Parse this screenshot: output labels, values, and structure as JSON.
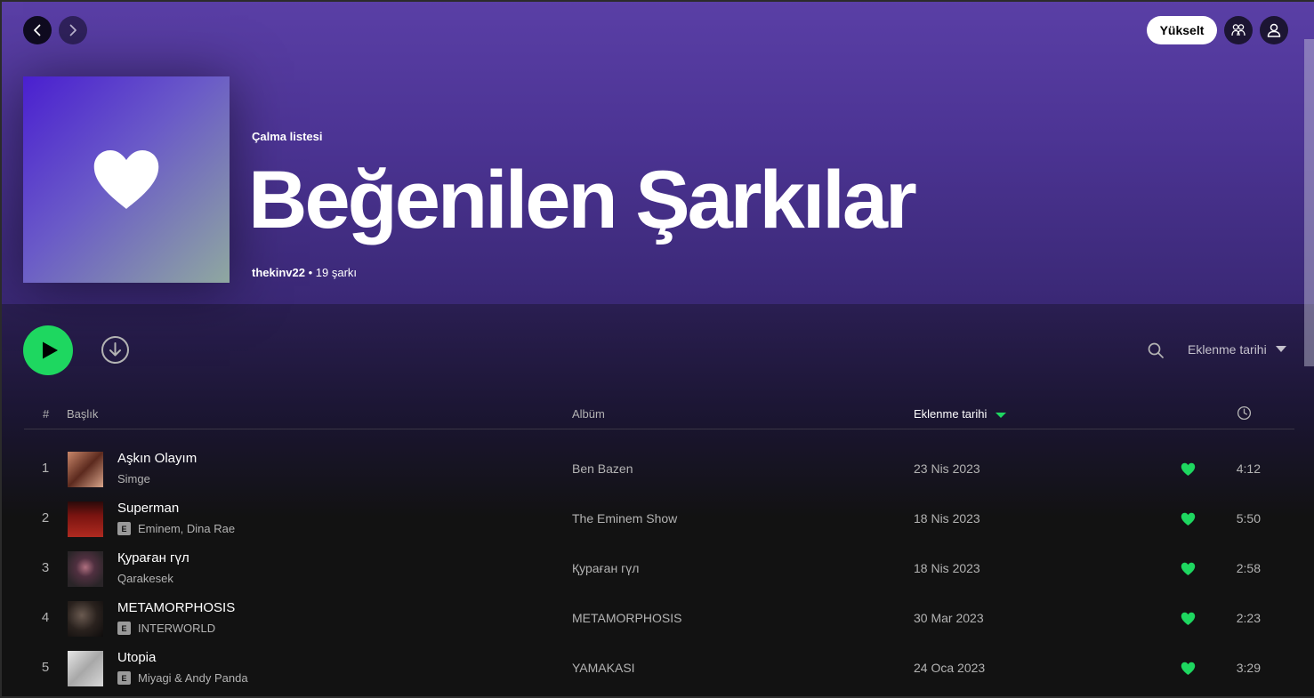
{
  "topbar": {
    "upgrade_label": "Yükselt",
    "icons": {
      "back": "chevron-left-icon",
      "forward": "chevron-right-icon",
      "friends": "friends-icon",
      "user": "user-icon"
    }
  },
  "playlist": {
    "type_label": "Çalma listesi",
    "title": "Beğenilen Şarkılar",
    "owner": "thekinv22",
    "separator": " • ",
    "song_count": "19 şarkı",
    "cover_icon": "heart-icon"
  },
  "actions": {
    "sort_label": "Eklenme tarihi"
  },
  "table": {
    "headers": {
      "number": "#",
      "title": "Başlık",
      "album": "Albüm",
      "date_added": "Eklenme tarihi",
      "duration_icon": "clock-icon"
    },
    "rows": [
      {
        "number": "1",
        "title": "Aşkın Olayım",
        "artist": "Simge",
        "explicit": false,
        "album": "Ben Bazen",
        "date": "23 Nis 2023",
        "duration": "4:12",
        "liked": true
      },
      {
        "number": "2",
        "title": "Superman",
        "artist": "Eminem, Dina Rae",
        "explicit": true,
        "album": "The Eminem Show",
        "date": "18 Nis 2023",
        "duration": "5:50",
        "liked": true
      },
      {
        "number": "3",
        "title": "Қураған гүл",
        "artist": "Qarakesek",
        "explicit": false,
        "album": "Қураған гүл",
        "date": "18 Nis 2023",
        "duration": "2:58",
        "liked": true
      },
      {
        "number": "4",
        "title": "METAMORPHOSIS",
        "artist": "INTERWORLD",
        "explicit": true,
        "album": "METAMORPHOSIS",
        "date": "30 Mar 2023",
        "duration": "2:23",
        "liked": true
      },
      {
        "number": "5",
        "title": "Utopia",
        "artist": "Miyagi & Andy Panda",
        "explicit": true,
        "album": "YAMAKASI",
        "date": "24 Oca 2023",
        "duration": "3:29",
        "liked": true
      }
    ],
    "explicit_label": "E"
  },
  "colors": {
    "accent": "#1ed760",
    "hero_top": "#5a3fa6",
    "background": "#121212"
  }
}
